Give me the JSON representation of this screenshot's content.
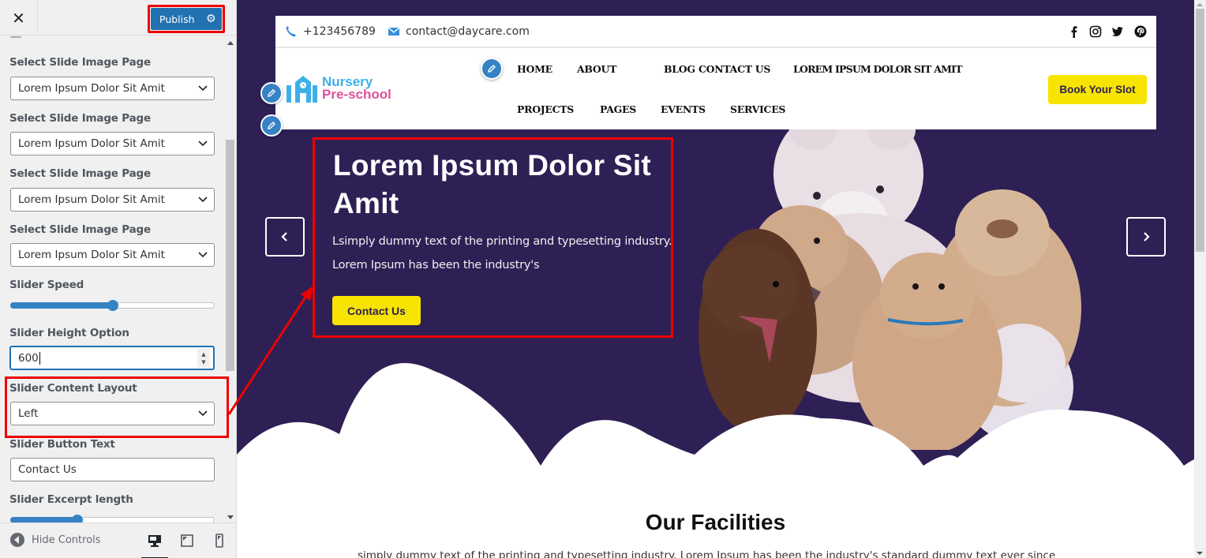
{
  "sidebar": {
    "close_label": "✕",
    "publish_label": "Publish",
    "controls": [
      {
        "label": "Select Slide Image Page",
        "value": "Lorem Ipsum Dolor Sit Amit"
      },
      {
        "label": "Select Slide Image Page",
        "value": "Lorem Ipsum Dolor Sit Amit"
      },
      {
        "label": "Select Slide Image Page",
        "value": "Lorem Ipsum Dolor Sit Amit"
      },
      {
        "label": "Select Slide Image Page",
        "value": "Lorem Ipsum Dolor Sit Amit"
      }
    ],
    "slider_speed": {
      "label": "Slider Speed",
      "percent": 50
    },
    "slider_height": {
      "label": "Slider Height Option",
      "value": "600"
    },
    "content_layout": {
      "label": "Slider Content Layout",
      "value": "Left"
    },
    "button_text": {
      "label": "Slider Button Text",
      "value": "Contact Us"
    },
    "excerpt_length": {
      "label": "Slider Excerpt length",
      "percent": 33
    },
    "hide_controls_label": "Hide Controls",
    "devices": [
      "desktop",
      "tablet",
      "mobile"
    ],
    "active_device": "desktop"
  },
  "site": {
    "topbar": {
      "phone": "+123456789",
      "email": "contact@daycare.com",
      "social": [
        "facebook",
        "instagram",
        "twitter",
        "pinterest"
      ]
    },
    "logo": {
      "line1": "Nursery",
      "line2": "Pre-school"
    },
    "nav": [
      "HOME",
      "ABOUT",
      "BLOG",
      "CONTACT US",
      "LOREM IPSUM DOLOR SIT AMIT",
      "PROJECTS",
      "PAGES",
      "EVENTS",
      "SERVICES"
    ],
    "book_button": "Book Your Slot",
    "slide": {
      "title": "Lorem Ipsum Dolor Sit Amit",
      "text_line1": "Lsimply dummy text of the printing and typesetting industry.",
      "text_line2": "Lorem Ipsum has been the industry's",
      "button": "Contact Us"
    },
    "facilities": {
      "title": "Our Facilities",
      "text": "simply dummy text of the printing and typesetting industry. Lorem Ipsum has been the industry's standard dummy text ever since"
    }
  },
  "colors": {
    "hero_bg": "#2e2055",
    "accent_yellow": "#f7e400",
    "publish_blue": "#2271b1",
    "annotation_red": "#ee0000",
    "logo_blue": "#3db0e8",
    "logo_pink": "#e0509a"
  }
}
